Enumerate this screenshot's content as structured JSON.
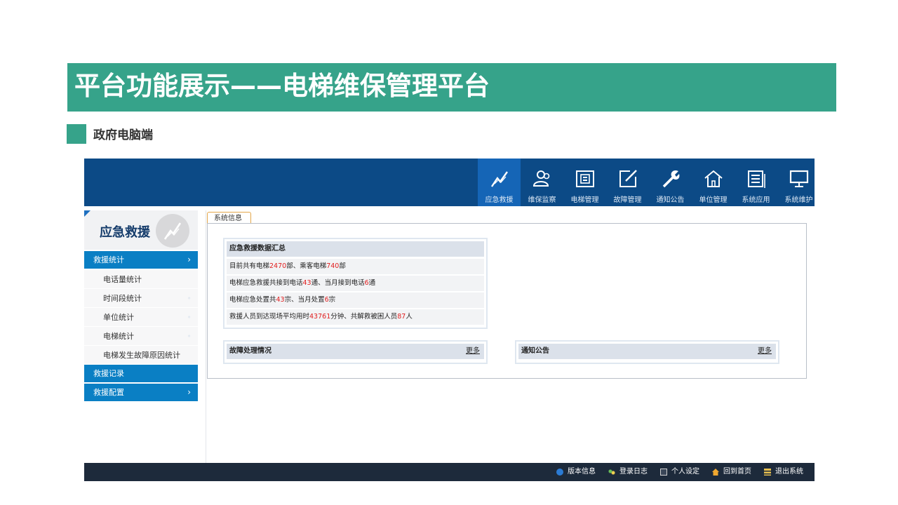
{
  "slide": {
    "title": "平台功能展示——电梯维保管理平台",
    "subtitle": "政府电脑端",
    "accent_color": "#36a38a"
  },
  "topnav": {
    "items": [
      {
        "label": "应急救援",
        "icon": "lightning-chart-icon",
        "active": true
      },
      {
        "label": "维保监察",
        "icon": "users-icon"
      },
      {
        "label": "电梯管理",
        "icon": "elevator-panel-icon"
      },
      {
        "label": "故障管理",
        "icon": "edit-icon"
      },
      {
        "label": "通知公告",
        "icon": "wrench-icon"
      },
      {
        "label": "单位管理",
        "icon": "home-icon"
      },
      {
        "label": "系统应用",
        "icon": "document-icon"
      },
      {
        "label": "系统维护",
        "icon": "monitor-icon"
      }
    ]
  },
  "sidebar": {
    "title": "应急救援",
    "categories": [
      {
        "label": "救援统计",
        "chevron": "›"
      },
      {
        "label": "救援记录"
      },
      {
        "label": "救援配置",
        "chevron": "›"
      }
    ],
    "subitems": [
      {
        "label": "电话量统计"
      },
      {
        "label": "时间段统计",
        "marker": "◦"
      },
      {
        "label": "单位统计",
        "marker": "◦"
      },
      {
        "label": "电梯统计",
        "marker": "◦"
      },
      {
        "label": "电梯发生故障原因统计"
      }
    ]
  },
  "content": {
    "tab": "系统信息",
    "summary": {
      "title": "应急救援数据汇总",
      "rows": [
        {
          "p1": "目前共有电梯",
          "n1": "2470",
          "p2": "部、乘客电梯",
          "n2": "740",
          "p3": "部"
        },
        {
          "p1": "电梯应急救援共接到电话",
          "n1": "43",
          "p2": "通、当月接到电话",
          "n2": "6",
          "p3": "通"
        },
        {
          "p1": "电梯应急处置共",
          "n1": "43",
          "p2": "宗、当月处置",
          "n2": "6",
          "p3": "宗"
        },
        {
          "p1": "救援人员到达现场平均用时",
          "n1": "43761",
          "p2": "分钟、共解救被困人员",
          "n2": "87",
          "p3": "人"
        }
      ]
    },
    "fault_panel": {
      "title": "故障处理情况",
      "more": "更多"
    },
    "notice_panel": {
      "title": "通知公告",
      "more": "更多"
    }
  },
  "footer": {
    "links": [
      {
        "label": "版本信息",
        "icon": "info-icon",
        "color": "#2b7bd4"
      },
      {
        "label": "登录日志",
        "icon": "users-small-icon",
        "color": "#6bbf59"
      },
      {
        "label": "个人设定",
        "icon": "settings-doc-icon",
        "color": "#d0d0d0"
      },
      {
        "label": "回到首页",
        "icon": "home-small-icon",
        "color": "#f0a830"
      },
      {
        "label": "退出系统",
        "icon": "exit-icon",
        "color": "#e8c050"
      }
    ]
  }
}
